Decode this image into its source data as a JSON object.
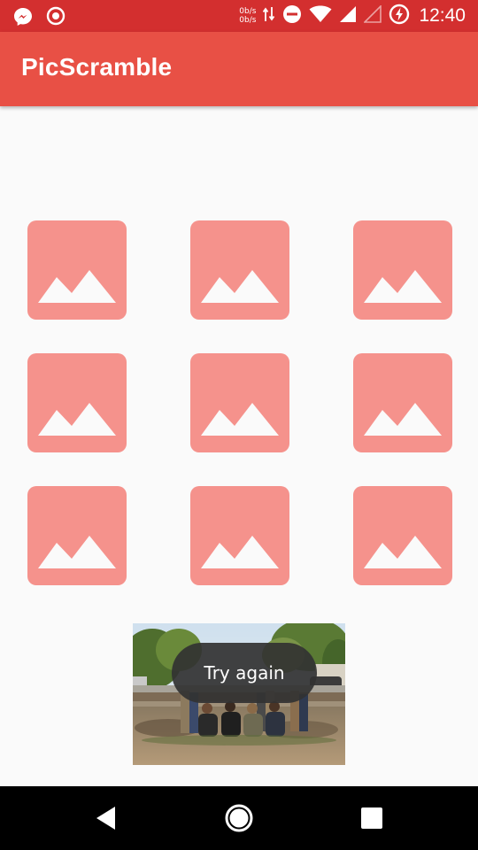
{
  "status_bar": {
    "net_up": "0b/s",
    "net_down": "0b/s",
    "time": "12:40",
    "icons": [
      "messenger-icon",
      "target-icon",
      "data-arrows-icon",
      "dnd-icon",
      "wifi-icon",
      "cell-signal-icon",
      "no-sim-signal-icon",
      "battery-saver-icon"
    ]
  },
  "app_bar": {
    "title": "PicScramble"
  },
  "grid": {
    "tile_icon": "image-placeholder-icon",
    "tile_color": "#f5928c",
    "tile_count": 9
  },
  "toast": {
    "text": "Try again"
  },
  "nav_bar": {
    "icons": [
      "back-icon",
      "home-icon",
      "recents-icon"
    ]
  },
  "colors": {
    "status_bar": "#d32f2f",
    "app_bar": "#e85045",
    "background": "#fafafa",
    "toast_bg": "#323232"
  }
}
